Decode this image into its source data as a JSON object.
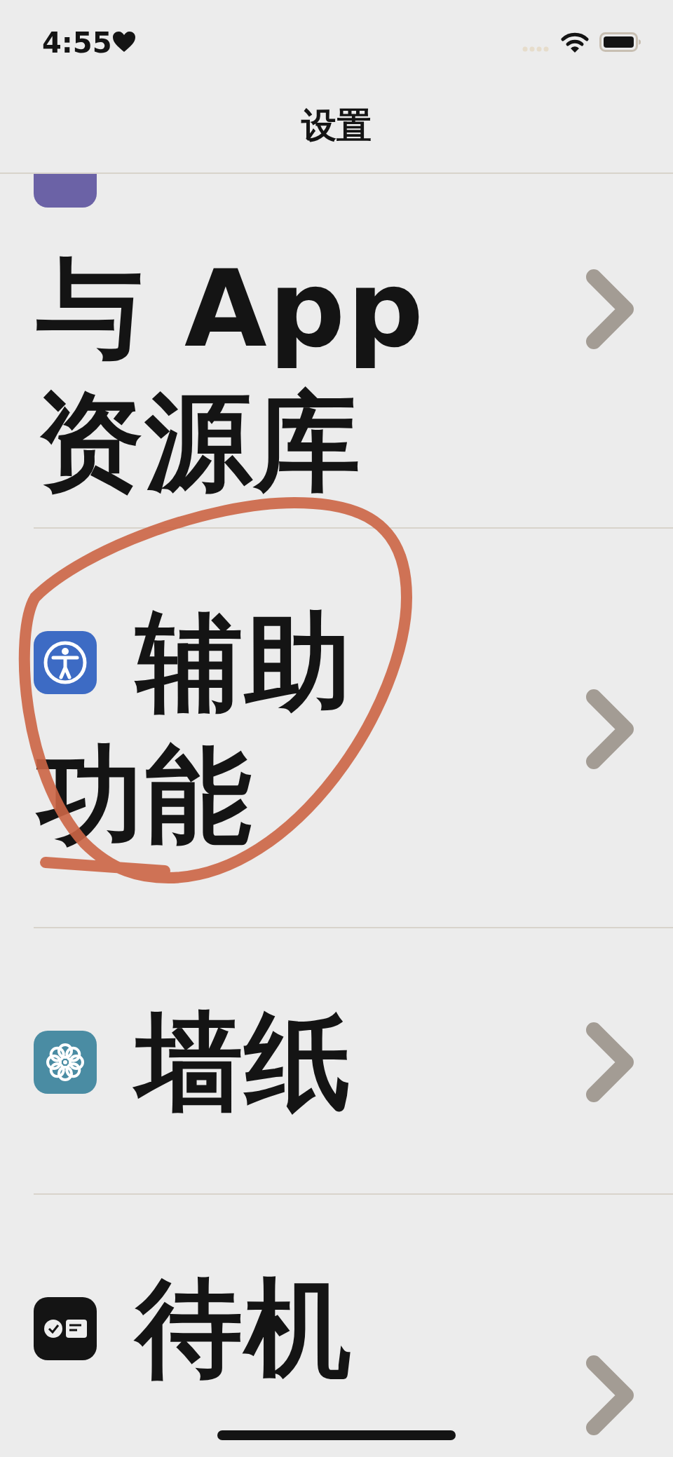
{
  "status_bar": {
    "time": "4:55"
  },
  "nav": {
    "title": "设置"
  },
  "rows": [
    {
      "lines": [
        "与 App",
        "资源库"
      ],
      "cut_top": true,
      "cut_bottom": false,
      "color": "#6b62a6",
      "circled": false
    },
    {
      "lines": [
        "辅助",
        "功能"
      ],
      "cut_top": false,
      "cut_bottom": false,
      "color": "#3d6bc4",
      "circled": true
    },
    {
      "lines": [
        "墙纸"
      ],
      "cut_top": false,
      "cut_bottom": false,
      "color": "#4a8ca3",
      "circled": false
    },
    {
      "lines": [
        "待机"
      ],
      "cut_top": false,
      "cut_bottom": true,
      "color": "#141414",
      "circled": false
    }
  ]
}
